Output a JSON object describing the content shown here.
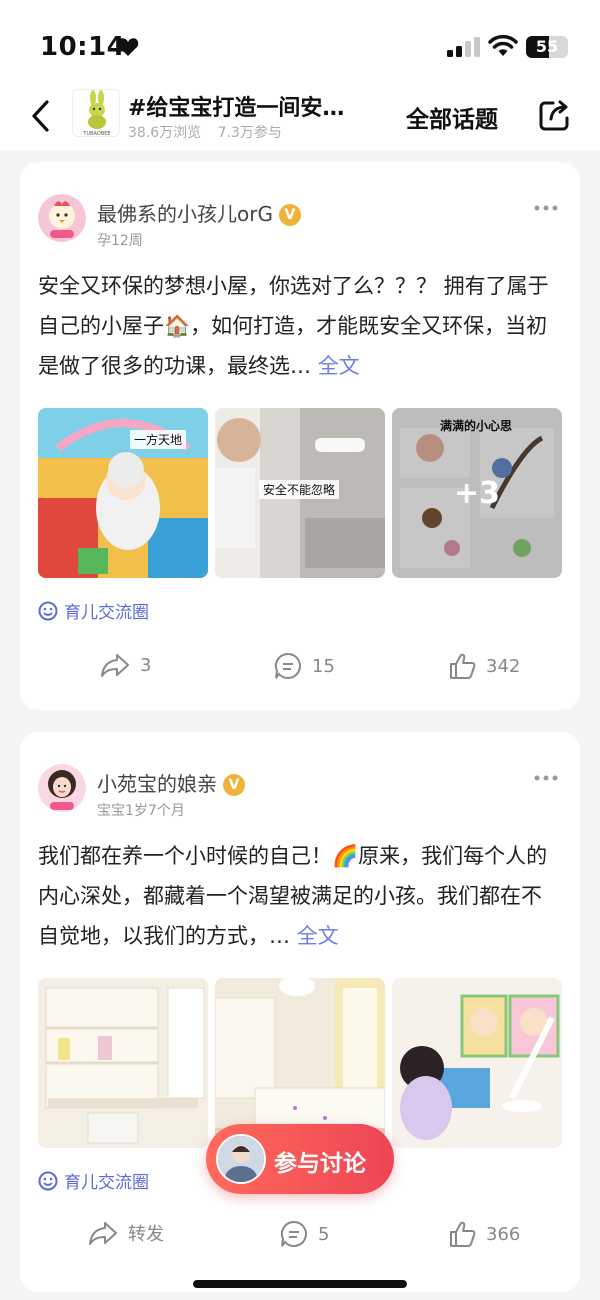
{
  "status": {
    "time": "10:14",
    "battery": "55",
    "battery_level_percent": 55
  },
  "nav": {
    "title": "#给宝宝打造一间安…",
    "views": "38.6万浏览",
    "participants": "7.3万参与",
    "all_topics": "全部话题",
    "topic_logo_text": "TUBAOBEE"
  },
  "posts": [
    {
      "username": "最佛系的小孩儿orG",
      "verified": "V",
      "subtitle": "孕12周",
      "text": "安全又环保的梦想小屋，你选对了么？？？ 拥有了属于自己的小屋子🏠，如何打造，才能既安全又环保，当初是做了很多的功课，最终选…",
      "full_text": "全文",
      "photo_captions": [
        "一方天地",
        "安全不能忽略",
        "满满的小心思"
      ],
      "extra_photos": "+3",
      "circle": "育儿交流圈",
      "shares": "3",
      "comments": "15",
      "likes": "342"
    },
    {
      "username": "小苑宝的娘亲",
      "verified": "V",
      "subtitle": "宝宝1岁7个月",
      "text": "我们都在养一个小时候的自己！🌈原来，我们每个人的内心深处，都藏着一个渴望被满足的小孩。我们都在不自觉地，以我们的方式，…",
      "full_text": "全文",
      "circle": "育儿交流圈",
      "shares": "转发",
      "comments": "5",
      "likes": "366"
    }
  ],
  "fab": {
    "label": "参与讨论"
  },
  "colors": {
    "accent_blue": "#6b7de6",
    "fab_red": "#ee4455",
    "badge_gold": "#f0b23a"
  }
}
